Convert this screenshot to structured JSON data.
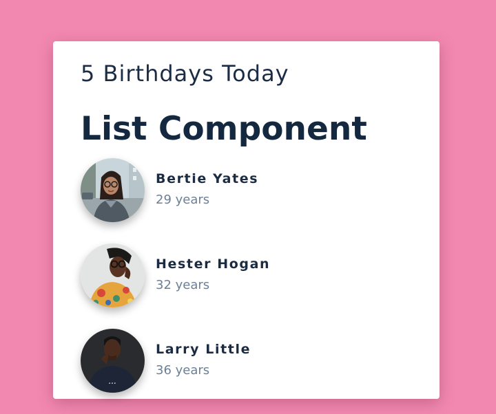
{
  "header": {
    "subtitle": "5 Birthdays Today",
    "title": "List Component"
  },
  "people": [
    {
      "name": "Bertie Yates",
      "age": "29 years",
      "photo_icon": "woman-glasses-street-photo"
    },
    {
      "name": "Hester Hogan",
      "age": "32 years",
      "photo_icon": "woman-glasses-colorful-shirt-photo"
    },
    {
      "name": "Larry Little",
      "age": "36 years",
      "photo_icon": "man-dark-tshirt-photo"
    }
  ],
  "colors": {
    "page_background": "#f288b0",
    "card_background": "#ffffff",
    "heading_text": "#142840",
    "secondary_text": "#6b7f96"
  }
}
